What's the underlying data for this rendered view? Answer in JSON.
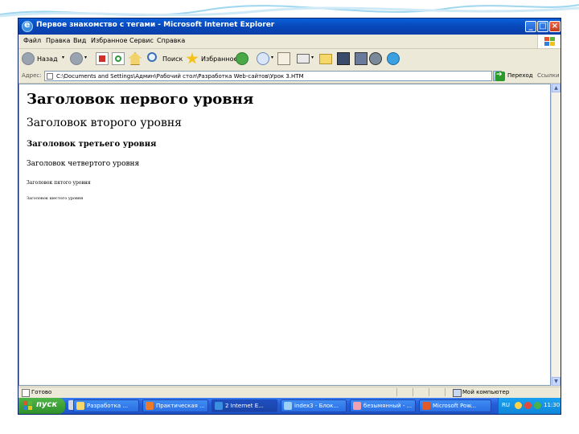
{
  "window": {
    "title": "Первое знакомство с тегами - Microsoft Internet Explorer"
  },
  "menu": [
    "Файл",
    "Правка",
    "Вид",
    "Избранное",
    "Сервис",
    "Справка"
  ],
  "toolbar": {
    "back_label": "Назад",
    "search_label": "Поиск",
    "favorites_label": "Избранное"
  },
  "addressbar": {
    "label": "Адрес:",
    "value": "C:\\Documents and Settings\\Админ\\Рабочий стол\\Разработка Web-сайтов\\Урок 3.HTM",
    "go_label": "Переход",
    "links_label": "Ссылки"
  },
  "page": {
    "h1": "Заголовок первого уровня",
    "h2": "Заголовок второго уровня",
    "h3": "Заголовок третьего уровня",
    "h4": "Заголовок четвертого уровня",
    "h5": "Заголовок пятого уровня",
    "h6": "Заголовок шестого уровня"
  },
  "status": {
    "text": "Готово",
    "zone": "Мой компьютер"
  },
  "taskbar": {
    "start_label": "пуск",
    "tasks": [
      "Разработка ...",
      "Практическая ...",
      "2 Internet E...",
      "index3 - Блок...",
      "безымянный - ...",
      "Microsoft Pow..."
    ],
    "language": "RU",
    "clock": "11:30"
  },
  "colors": {
    "titlebar": "#0a5fd8",
    "taskbar": "#245edb",
    "start": "#2f8f2a",
    "chrome": "#ece9d8"
  }
}
